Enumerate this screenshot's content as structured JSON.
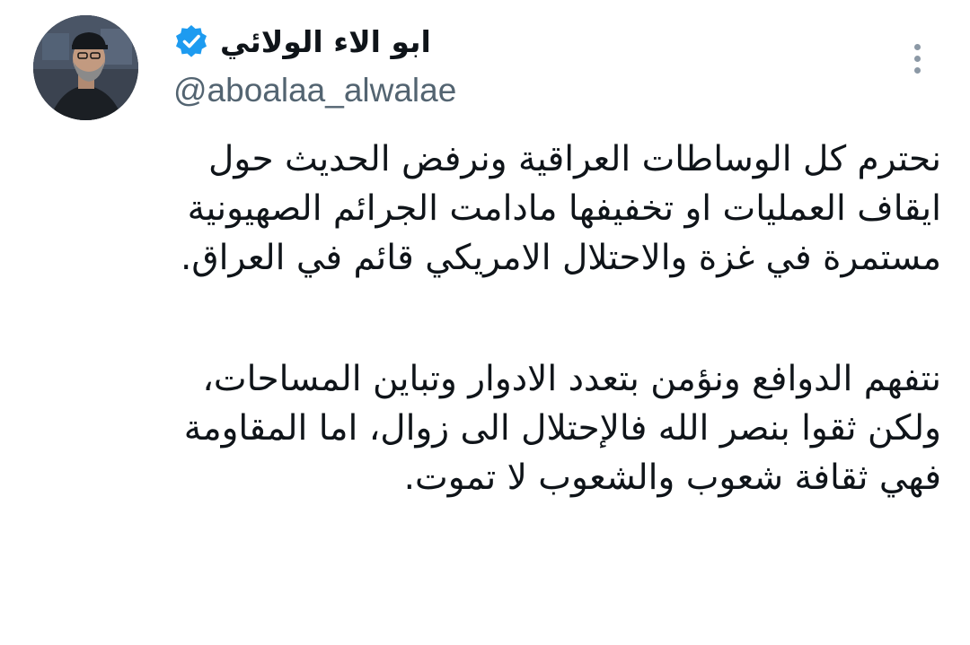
{
  "author": {
    "display_name": "ابو الاء الولائي",
    "handle": "@aboalaa_alwalae",
    "verified": true,
    "avatar_icon": "profile-photo"
  },
  "menu": {
    "icon": "more-vertical-icon"
  },
  "tweet": {
    "paragraphs": [
      {
        "lines": [
          "نحترم كل الوساطات العراقية ونرفض الحديث حول",
          "ايقاف العمليات او تخفيفها مادامت الجرائم الصهيونية",
          "مستمرة في غزة والاحتلال الامريكي قائم في العراق."
        ]
      },
      {
        "lines": [
          "نتفهم الدوافع ونؤمن بتعدد الادوار وتباين المساحات،",
          "ولكن ثقوا بنصر الله فالإحتلال الى زوال، اما المقاومة",
          "فهي ثقافة شعوب والشعوب لا تموت."
        ]
      }
    ]
  },
  "colors": {
    "verified_badge": "#1d9bf0",
    "handle_text": "#536471",
    "body_text": "#0f1419",
    "menu_dots": "#8b98a5"
  }
}
